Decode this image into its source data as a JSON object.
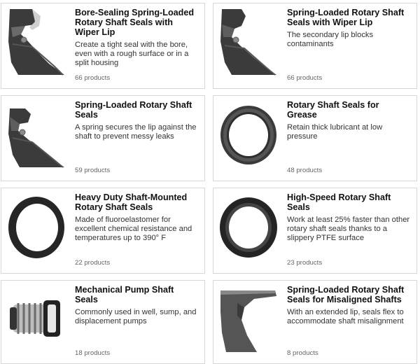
{
  "products": [
    {
      "title": "Bore-Sealing Spring-Loaded Rotary Shaft Seals with Wiper Lip",
      "description": "Create a tight seal with the bore, even with a rough surface or in a split housing",
      "count": "66 products",
      "icon": "profile-seal-wiper-icon"
    },
    {
      "title": "Spring-Loaded Rotary Shaft Seals with Wiper Lip",
      "description": "The secondary lip blocks contaminants",
      "count": "66 products",
      "icon": "profile-seal-wiper-icon"
    },
    {
      "title": "Spring-Loaded Rotary Shaft Seals",
      "description": "A spring secures the lip against the shaft to prevent messy leaks",
      "count": "59 products",
      "icon": "profile-seal-spring-icon"
    },
    {
      "title": "Rotary Shaft Seals for Grease",
      "description": "Retain thick lubricant at low pressure",
      "count": "48 products",
      "icon": "seal-ring-icon"
    },
    {
      "title": "Heavy Duty Shaft-Mounted Rotary Shaft Seals",
      "description": "Made of fluoroelastomer for excellent chemical resistance and temperatures up to 390° F",
      "count": "22 products",
      "icon": "seal-ring-icon"
    },
    {
      "title": "High-Speed Rotary Shaft Seals",
      "description": "Work at least 25% faster than other rotary shaft seals thanks to a slippery PTFE surface",
      "count": "23 products",
      "icon": "seal-ring-icon"
    },
    {
      "title": "Mechanical Pump Shaft Seals",
      "description": "Commonly used in well, sump, and displacement pumps",
      "count": "18 products",
      "icon": "mechanical-seal-icon"
    },
    {
      "title": "Spring-Loaded Rotary Shaft Seals for Misaligned Shafts",
      "description": "With an extended lip, seals flex to accommodate shaft misalignment",
      "count": "8 products",
      "icon": "profile-seal-extended-icon"
    }
  ]
}
